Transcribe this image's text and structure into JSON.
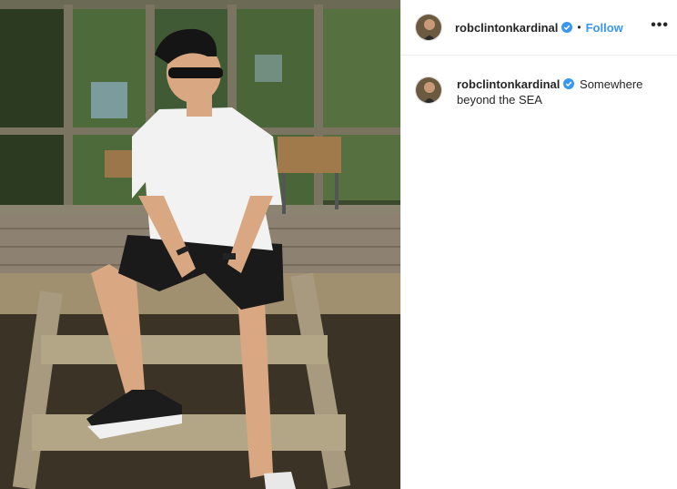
{
  "post": {
    "username": "robclintonkardinal",
    "follow_label": "Follow",
    "separator": "•",
    "more_label": "•••",
    "caption": "Somewhere beyond the SEA"
  },
  "colors": {
    "link": "#3897f0",
    "verified": "#3897f0",
    "border": "#efefef",
    "text": "#262626"
  },
  "icons": [
    "verified-badge-icon",
    "more-options-icon"
  ]
}
